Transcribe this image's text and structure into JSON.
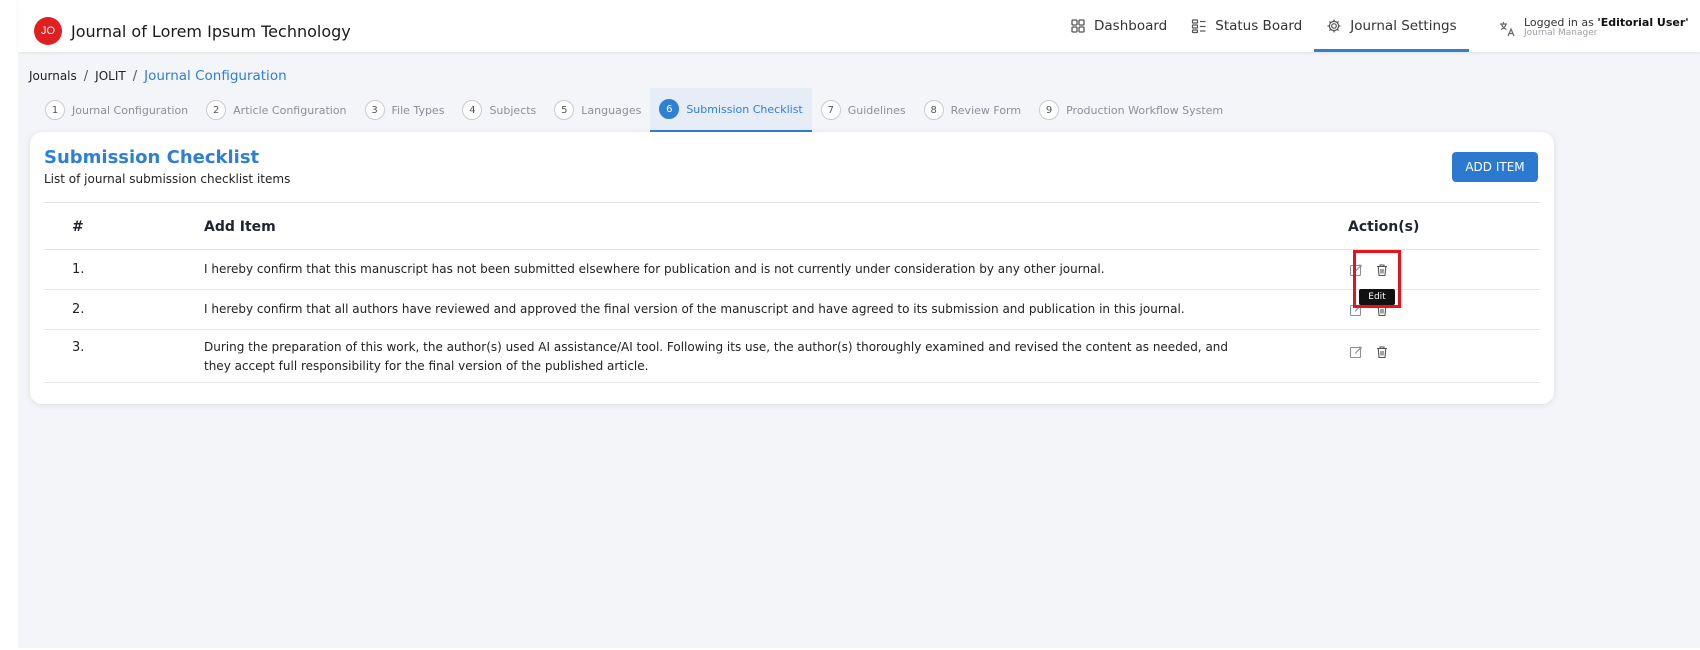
{
  "app": {
    "logo_text": "JO",
    "journal_name": "Journal of Lorem Ipsum Technology",
    "accent_color": "#2f7fd3",
    "logo_color": "#e02020"
  },
  "nav": {
    "dashboard": "Dashboard",
    "status_board": "Status Board",
    "journal_settings": "Journal Settings"
  },
  "user": {
    "logged_in_prefix": "Logged in as ",
    "name": "'Editorial User'",
    "role": "Journal Manager"
  },
  "breadcrumb": {
    "root": "Journals",
    "journal": "JOLIT",
    "current": "Journal Configuration"
  },
  "steps": [
    {
      "num": "1",
      "label": "Journal Configuration"
    },
    {
      "num": "2",
      "label": "Article Configuration"
    },
    {
      "num": "3",
      "label": "File Types"
    },
    {
      "num": "4",
      "label": "Subjects"
    },
    {
      "num": "5",
      "label": "Languages"
    },
    {
      "num": "6",
      "label": "Submission Checklist"
    },
    {
      "num": "7",
      "label": "Guidelines"
    },
    {
      "num": "8",
      "label": "Review Form"
    },
    {
      "num": "9",
      "label": "Production Workflow System"
    }
  ],
  "active_step": "6",
  "card": {
    "title": "Submission Checklist",
    "subtitle": "List of journal submission checklist items",
    "add_button": "ADD ITEM"
  },
  "table": {
    "headers": {
      "index": "#",
      "item": "Add Item",
      "actions": "Action(s)"
    },
    "rows": [
      {
        "index": "1.",
        "text": "I hereby confirm that this manuscript has not been submitted elsewhere for publication and is not currently under consideration by any other journal."
      },
      {
        "index": "2.",
        "text": "I hereby confirm that all authors have reviewed and approved the final version of the manuscript and have agreed to its submission and publication in this journal."
      },
      {
        "index": "3.",
        "text": "During the preparation of this work, the author(s) used AI assistance/AI tool. Following its use, the author(s) thoroughly examined and revised the content as needed, and they accept full responsibility for the final version of the published article."
      }
    ]
  },
  "tooltip": {
    "edit": "Edit"
  }
}
